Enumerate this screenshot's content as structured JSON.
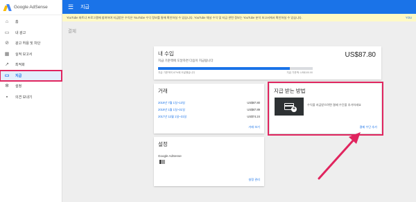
{
  "app": {
    "name": "Google AdSense"
  },
  "topbar": {
    "title": "지급"
  },
  "notice": {
    "text": "YouTube 파트너 프로그램에 참여하여 지급받은 수익은 YouTube 수익 정보를 통해 확인하실 수 있습니다. YouTube 채널 수익 및 지급 관련 정보는 YouTube 분석 보고서에서 확인하실 수 있습니다.",
    "link": "YOU"
  },
  "subheader": {
    "label": "결제"
  },
  "sidebar": {
    "items": [
      {
        "label": "홈",
        "icon": "home-icon",
        "glyph": "⌂"
      },
      {
        "label": "내 광고",
        "icon": "ads-icon",
        "glyph": "▭"
      },
      {
        "label": "광고 허용 및 차단",
        "icon": "block-icon",
        "glyph": "⊘"
      },
      {
        "label": "실적 보고서",
        "icon": "report-icon",
        "glyph": "▦"
      },
      {
        "label": "최적화",
        "icon": "optimize-icon",
        "glyph": "↗"
      },
      {
        "label": "지급",
        "icon": "payments-icon",
        "glyph": "▭"
      },
      {
        "label": "설정",
        "icon": "gear-icon",
        "glyph": "✻"
      },
      {
        "label": "의견 보내기",
        "icon": "feedback-icon",
        "glyph": "▪"
      }
    ]
  },
  "income": {
    "title": "내 수입",
    "subtitle": "지급 기준액에 도달하면 다음이 지급됩니다",
    "amount": "US$87.80",
    "progress": 0.85,
    "progress_left": "지급 기준액의 87%에 도달했습니다",
    "progress_right": "지급 기준액: US$100.00"
  },
  "transactions": {
    "title": "거래",
    "rows": [
      {
        "date": "2019년 7월 1일~13일",
        "amount": "US$87.80"
      },
      {
        "date": "2019년 1월 1일~31일",
        "amount": "US$87.89"
      },
      {
        "date": "2017년 12월 1일~31일",
        "amount": "US$74.24"
      }
    ],
    "view_link": "거래 보기"
  },
  "settings": {
    "title": "설정",
    "account_name": "Google AdSense",
    "manage_link": "설정 관리"
  },
  "payment_method": {
    "title": "지급 받는 방법",
    "description": "수익을 지급받으려면 결제 수단을 추가하세요",
    "add_link": "결제 수단 추가"
  },
  "colors": {
    "primary": "#1a73e8",
    "highlight": "#e0245e",
    "notice_bg": "#fff9c4"
  }
}
